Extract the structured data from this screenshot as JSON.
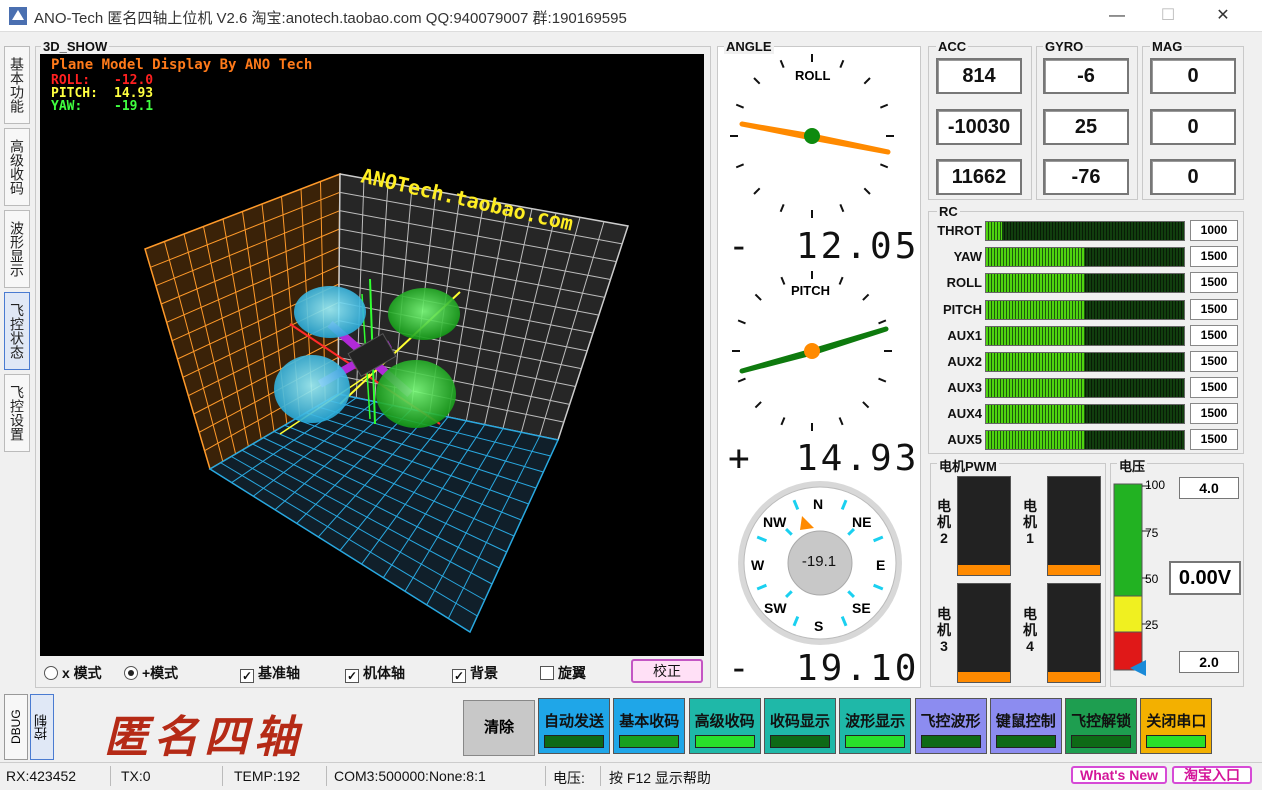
{
  "window": {
    "title": "ANO-Tech   匿名四轴上位机   V2.6   淘宝:anotech.taobao.com   QQ:940079007   群:190169595",
    "minimize": "—",
    "maximize": "☐",
    "close": "✕"
  },
  "side_tabs": [
    "基本功能",
    "高级收码",
    "波形显示",
    "飞控状态",
    "飞控设置"
  ],
  "active_tab": "飞控状态",
  "view3d": {
    "label": "3D_SHOW",
    "header": "Plane Model Display By ANO Tech",
    "roll_label": "ROLL:",
    "roll_value": "-12.0",
    "pitch_label": "PITCH:",
    "pitch_value": "14.93",
    "yaw_label": "YAW:",
    "yaw_value": "-19.1",
    "watermark": "ANOTech.taobao.com",
    "colors": {
      "header": "#ff7a1a",
      "roll": "#ff2020",
      "pitch": "#ffff40",
      "yaw": "#40ff40",
      "watermark": "#ffee22"
    }
  },
  "view_options": {
    "x_mode": "x 模式",
    "plus_mode": "+模式",
    "mode_selected": "plus",
    "base_axis": "基准轴",
    "body_axis": "机体轴",
    "background": "背景",
    "rotor": "旋翼",
    "checked": {
      "base_axis": true,
      "body_axis": true,
      "background": true,
      "rotor": false
    },
    "calibrate_button": "校正"
  },
  "angle": {
    "label": "ANGLE",
    "roll_label": "ROLL",
    "roll_sign": "-",
    "roll_value": "12.05",
    "pitch_label": "PITCH",
    "pitch_sign": "+",
    "pitch_value": "14.93",
    "yaw_sign": "-",
    "yaw_value": "19.10",
    "compass_value": "-19.1",
    "compass": {
      "n": "N",
      "ne": "NE",
      "e": "E",
      "se": "SE",
      "s": "S",
      "sw": "SW",
      "w": "W",
      "nw": "NW"
    }
  },
  "sensors": {
    "acc_label": "ACC",
    "gyro_label": "GYRO",
    "mag_label": "MAG",
    "acc": [
      "814",
      "-10030",
      "11662"
    ],
    "gyro": [
      "-6",
      "25",
      "-76"
    ],
    "mag": [
      "0",
      "0",
      "0"
    ]
  },
  "rc": {
    "label": "RC",
    "channels": [
      {
        "name": "THROT",
        "value": "1000",
        "level": 0.0
      },
      {
        "name": "YAW",
        "value": "1500",
        "level": 0.5
      },
      {
        "name": "ROLL",
        "value": "1500",
        "level": 0.5
      },
      {
        "name": "PITCH",
        "value": "1500",
        "level": 0.5
      },
      {
        "name": "AUX1",
        "value": "1500",
        "level": 0.5
      },
      {
        "name": "AUX2",
        "value": "1500",
        "level": 0.5
      },
      {
        "name": "AUX3",
        "value": "1500",
        "level": 0.5
      },
      {
        "name": "AUX4",
        "value": "1500",
        "level": 0.5
      },
      {
        "name": "AUX5",
        "value": "1500",
        "level": 0.5
      }
    ]
  },
  "motor": {
    "label": "电机PWM",
    "m2": "电机2",
    "m1": "电机1",
    "m3": "电机3",
    "m4": "电机4",
    "levels": {
      "m1": 0.1,
      "m2": 0.1,
      "m3": 0.1,
      "m4": 0.1
    }
  },
  "voltage": {
    "label": "电压",
    "ticks": [
      "100",
      "75",
      "50",
      "25"
    ],
    "max": "4.0",
    "min": "2.0",
    "current": "0.00V"
  },
  "bottom": {
    "dbug": "DBUG",
    "control": "控制",
    "brand": "匿名四轴",
    "clear": "清除",
    "buttons": [
      {
        "label": "自动发送",
        "bg": "#1fa6e8",
        "led": "#0e6a16"
      },
      {
        "label": "基本收码",
        "bg": "#1fa6e8",
        "led": "#18a020"
      },
      {
        "label": "高级收码",
        "bg": "#1fb8a8",
        "led": "#29e02a"
      },
      {
        "label": "收码显示",
        "bg": "#1fb8a8",
        "led": "#0e6a16"
      },
      {
        "label": "波形显示",
        "bg": "#1fb8a8",
        "led": "#29e02a"
      },
      {
        "label": "飞控波形",
        "bg": "#8c8cf0",
        "led": "#0e6a16"
      },
      {
        "label": "键鼠控制",
        "bg": "#8c8cf0",
        "led": "#0e6a16"
      },
      {
        "label": "飞控解锁",
        "bg": "#1e9e50",
        "led": "#0e6a16"
      },
      {
        "label": "关闭串口",
        "bg": "#f3b000",
        "led": "#29e02a"
      }
    ]
  },
  "status": {
    "rx": "RX:423452",
    "tx": "TX:0",
    "temp": "TEMP:192",
    "port": "COM3:500000:None:8:1",
    "voltage": "电压:",
    "help": "按 F12 显示帮助",
    "whats_new": "What's New",
    "shop": "淘宝入口"
  }
}
